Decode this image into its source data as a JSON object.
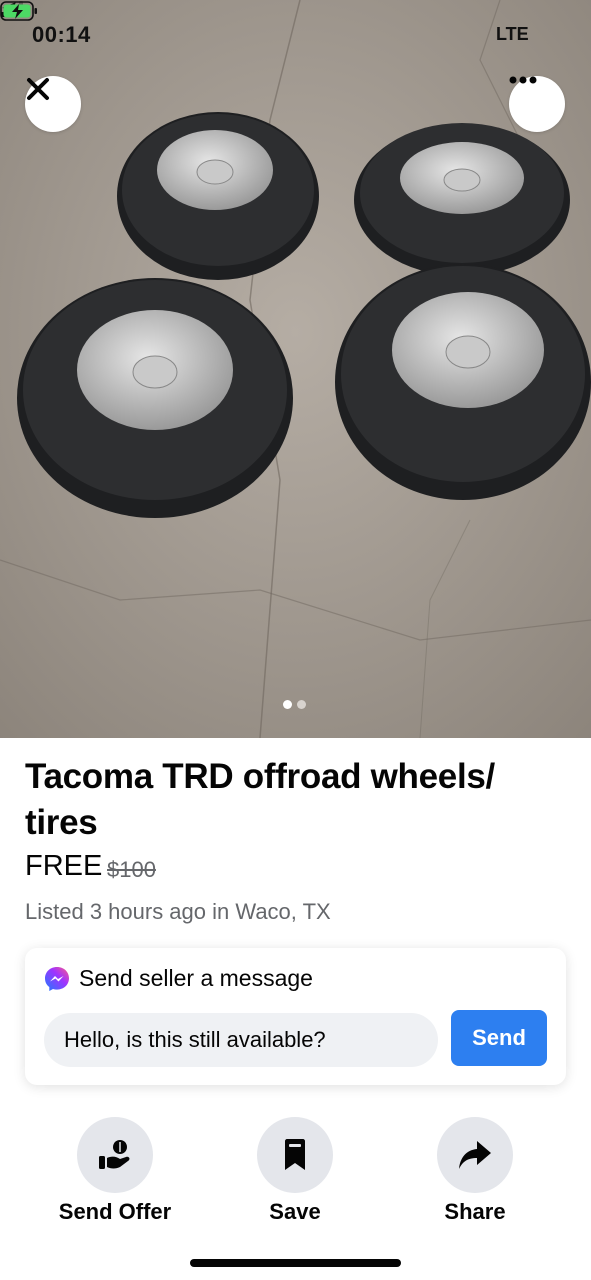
{
  "status_bar": {
    "time": "00:14",
    "network": "LTE",
    "icons": [
      "location-arrow-icon",
      "signal-bars-icon",
      "battery-charging-icon"
    ]
  },
  "photo": {
    "description_icons": [
      "close-icon",
      "more-icon"
    ],
    "carousel_count": 2,
    "carousel_active": 0,
    "colors": {
      "active_dot": "#ffffff",
      "inactive_dot": "#d8d3ce"
    }
  },
  "listing": {
    "title": "Tacoma TRD offroad wheels/ tires",
    "price": "FREE",
    "original_price": "$100",
    "listed": "Listed 3 hours ago in Waco, TX"
  },
  "message": {
    "heading": "Send seller a message",
    "input_value": "Hello, is this still available?",
    "send_label": "Send",
    "icon": "messenger-icon"
  },
  "actions": [
    {
      "label": "Send Offer",
      "icon": "send-offer-icon"
    },
    {
      "label": "Save",
      "icon": "bookmark-icon"
    },
    {
      "label": "Share",
      "icon": "share-icon"
    }
  ],
  "colors": {
    "accent": "#2d7ff0",
    "text_primary": "#050505",
    "text_secondary": "#65676b",
    "action_circle": "#e4e6eb"
  }
}
